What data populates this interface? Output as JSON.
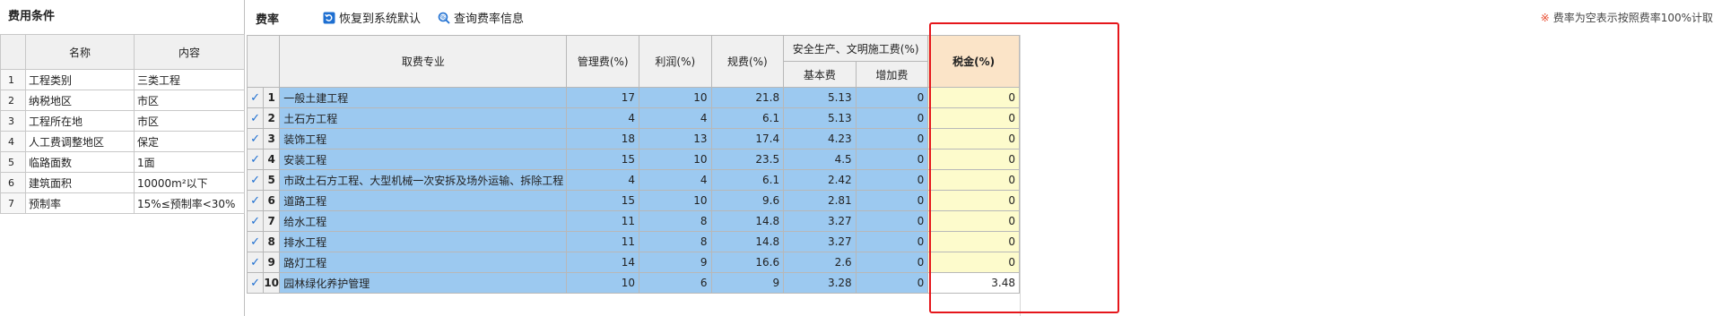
{
  "left": {
    "title": "费用条件",
    "headers": [
      "",
      "名称",
      "内容"
    ],
    "rows": [
      {
        "no": "1",
        "name": "工程类别",
        "value": "三类工程"
      },
      {
        "no": "2",
        "name": "纳税地区",
        "value": "市区"
      },
      {
        "no": "3",
        "name": "工程所在地",
        "value": "市区"
      },
      {
        "no": "4",
        "name": "人工费调整地区",
        "value": "保定"
      },
      {
        "no": "5",
        "name": "临路面数",
        "value": "1面"
      },
      {
        "no": "6",
        "name": "建筑面积",
        "value": "10000m²以下"
      },
      {
        "no": "7",
        "name": "预制率",
        "value": "15%≤预制率<30%"
      }
    ]
  },
  "toolbar": {
    "title": "费率",
    "restore_label": "恢复到系统默认",
    "query_label": "查询费率信息",
    "note": "费率为空表示按照费率100%计取",
    "note_symbol": "※"
  },
  "grid": {
    "headers": {
      "specialty": "取费专业",
      "mgmt": "管理费(%)",
      "profit": "利润(%)",
      "fee": "规费(%)",
      "safety_group": "安全生产、文明施工费(%)",
      "safety_basic": "基本费",
      "safety_add": "增加费",
      "tax": "税金(%)"
    },
    "rows": [
      {
        "no": "1",
        "name": "一般土建工程",
        "mgmt": "17",
        "profit": "10",
        "fee": "21.8",
        "basic": "5.13",
        "add": "0",
        "tax": "0"
      },
      {
        "no": "2",
        "name": "土石方工程",
        "mgmt": "4",
        "profit": "4",
        "fee": "6.1",
        "basic": "5.13",
        "add": "0",
        "tax": "0"
      },
      {
        "no": "3",
        "name": "装饰工程",
        "mgmt": "18",
        "profit": "13",
        "fee": "17.4",
        "basic": "4.23",
        "add": "0",
        "tax": "0"
      },
      {
        "no": "4",
        "name": "安装工程",
        "mgmt": "15",
        "profit": "10",
        "fee": "23.5",
        "basic": "4.5",
        "add": "0",
        "tax": "0"
      },
      {
        "no": "5",
        "name": "市政土石方工程、大型机械一次安拆及场外运输、拆除工程",
        "mgmt": "4",
        "profit": "4",
        "fee": "6.1",
        "basic": "2.42",
        "add": "0",
        "tax": "0"
      },
      {
        "no": "6",
        "name": "道路工程",
        "mgmt": "15",
        "profit": "10",
        "fee": "9.6",
        "basic": "2.81",
        "add": "0",
        "tax": "0"
      },
      {
        "no": "7",
        "name": "给水工程",
        "mgmt": "11",
        "profit": "8",
        "fee": "14.8",
        "basic": "3.27",
        "add": "0",
        "tax": "0"
      },
      {
        "no": "8",
        "name": "排水工程",
        "mgmt": "11",
        "profit": "8",
        "fee": "14.8",
        "basic": "3.27",
        "add": "0",
        "tax": "0"
      },
      {
        "no": "9",
        "name": "路灯工程",
        "mgmt": "14",
        "profit": "9",
        "fee": "16.6",
        "basic": "2.6",
        "add": "0",
        "tax": "0"
      },
      {
        "no": "10",
        "name": "园林绿化养护管理",
        "mgmt": "10",
        "profit": "6",
        "fee": "9",
        "basic": "3.28",
        "add": "0",
        "tax": "3.48"
      }
    ]
  },
  "colors": {
    "selected_row": "#9cc9f0",
    "tax_header": "#fbe4c8",
    "tax_cell": "#fdfbcc",
    "highlight_box": "#e5161b",
    "icon_blue": "#1e6fd1",
    "note_symbol": "#e8472a"
  }
}
